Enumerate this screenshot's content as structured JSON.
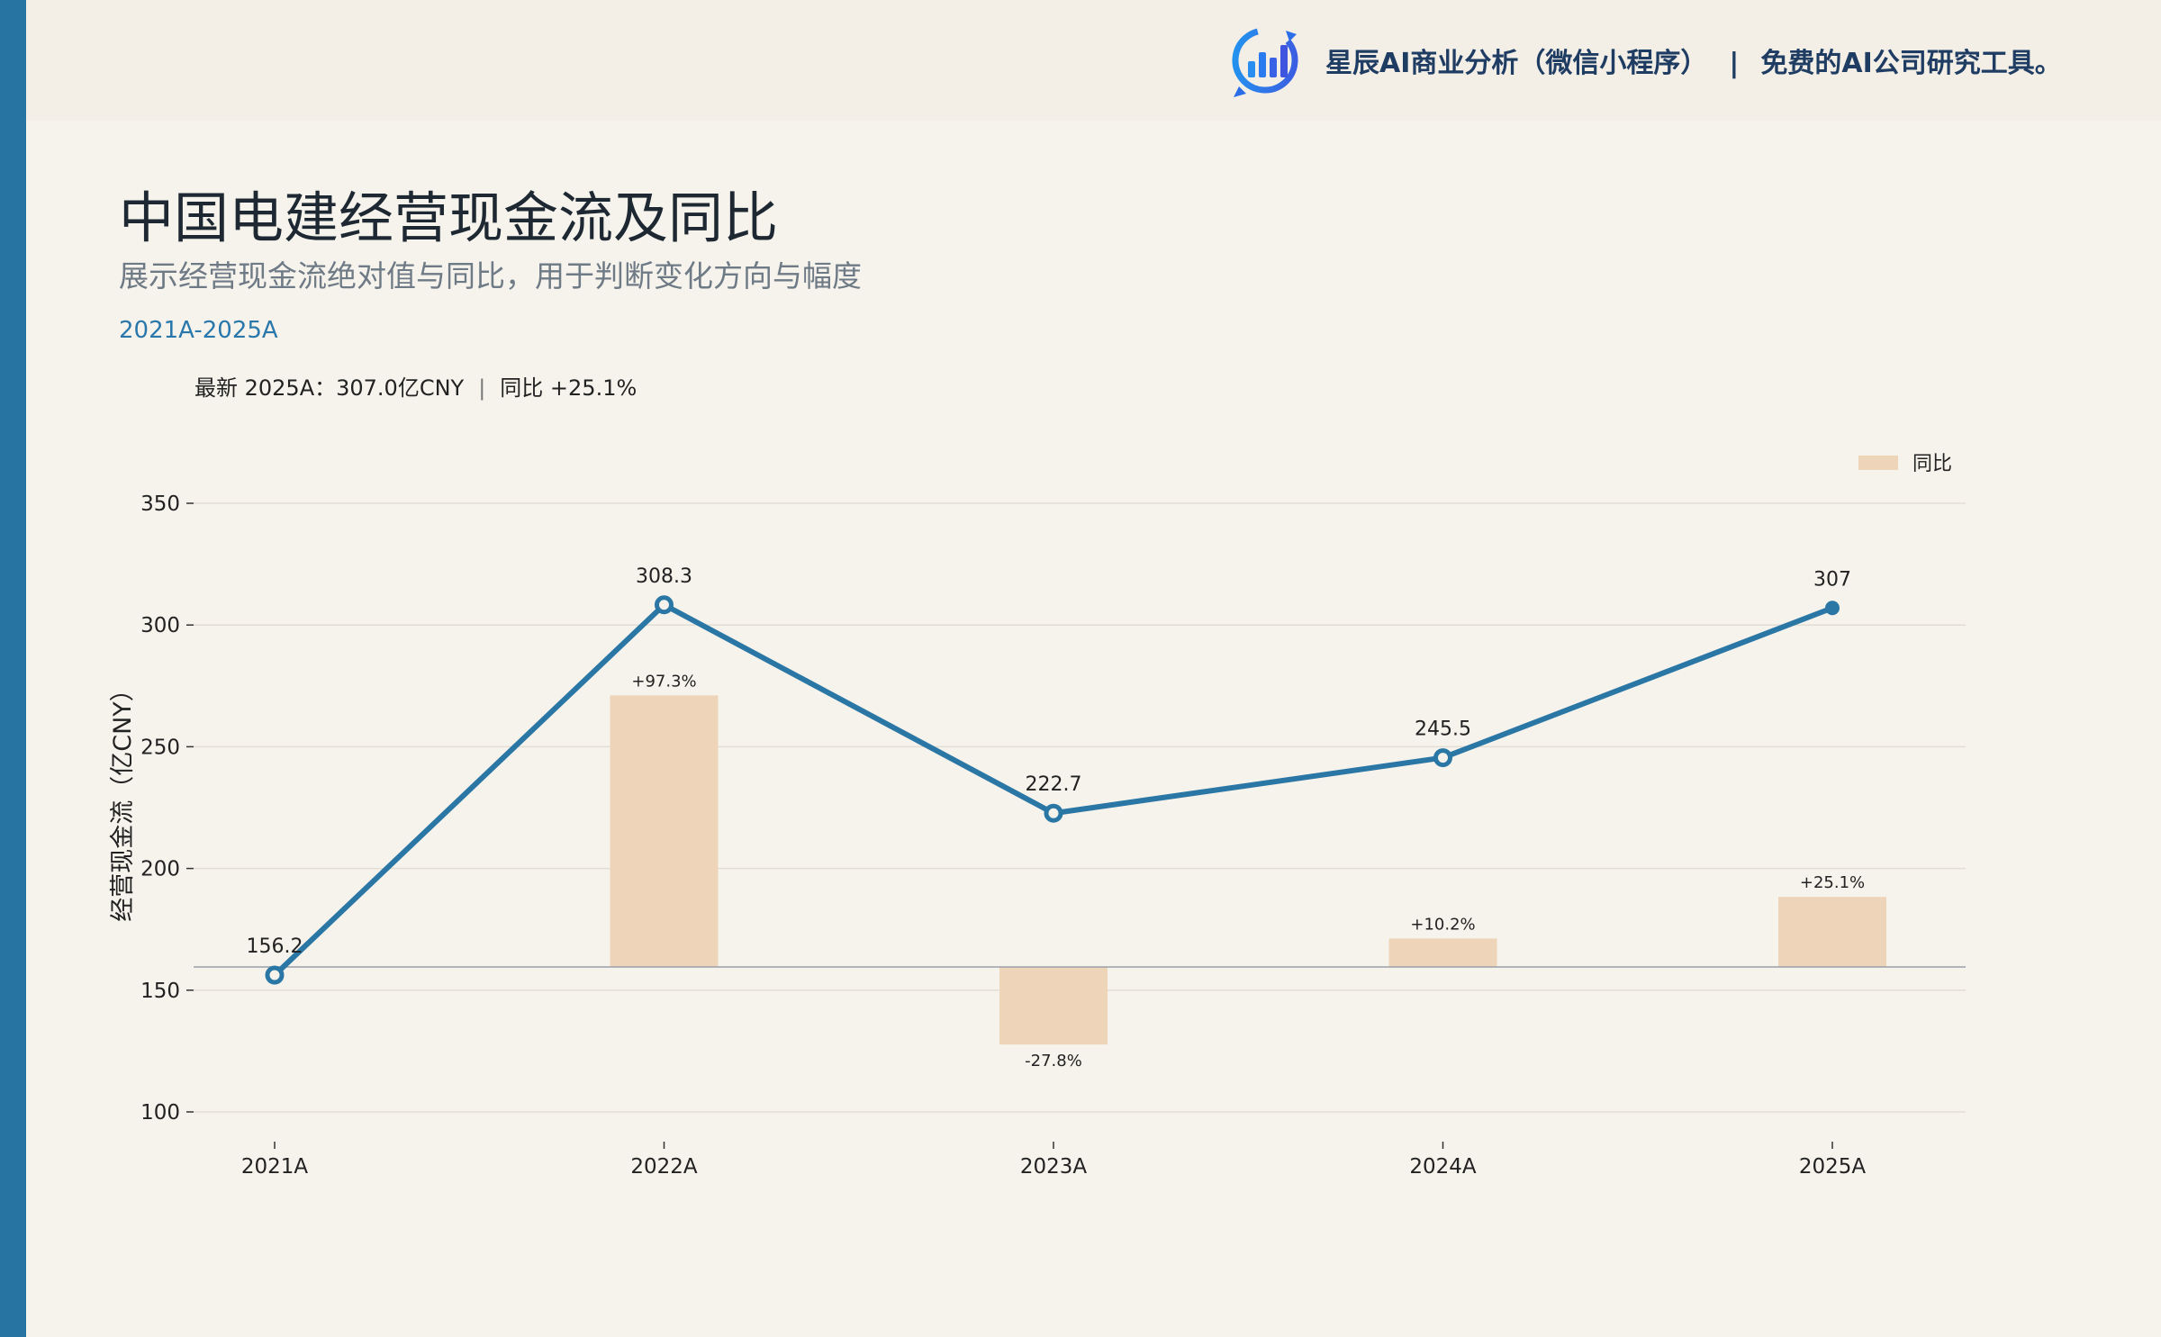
{
  "header": {
    "brand_name": "星辰AI商业分析（微信小程序）",
    "separator": "|",
    "tagline": "免费的AI公司研究工具。",
    "logo_icon": "bar-chart-cycle-logo-icon"
  },
  "title": "中国电建经营现金流及同比",
  "subtitle": "展示经营现金流绝对值与同比，用于判断变化方向与幅度",
  "period": "2021A-2025A",
  "latest": {
    "text": "最新 2025A：307.0亿CNY",
    "separator": "|",
    "yoy": "同比 +25.1%"
  },
  "colors": {
    "accent": "#2a76a4",
    "bar": "#eed5b9",
    "background": "#f6f3ec",
    "header_bg": "#f3efe7"
  },
  "chart_data": {
    "type": "line",
    "title": "中国电建经营现金流及同比",
    "categories": [
      "2021A",
      "2022A",
      "2023A",
      "2024A",
      "2025A"
    ],
    "ylabel": "经营现金流（亿CNY）",
    "ylim": [
      90,
      370
    ],
    "yticks": [
      100,
      150,
      200,
      250,
      300,
      350
    ],
    "grid": true,
    "legend_position": "top-right",
    "series": [
      {
        "type": "line",
        "values": [
          156.2,
          308.3,
          222.7,
          245.5,
          307
        ],
        "labels": [
          "156.2",
          "308.3",
          "222.7",
          "245.5",
          "307"
        ],
        "color": "#2a76a4"
      },
      {
        "name": "同比",
        "type": "bar",
        "values": [
          null,
          97.3,
          -27.8,
          10.2,
          25.1
        ],
        "labels": [
          "",
          "+97.3%",
          "-27.8%",
          "+10.2%",
          "+25.1%"
        ],
        "color": "#eed5b9"
      }
    ]
  }
}
